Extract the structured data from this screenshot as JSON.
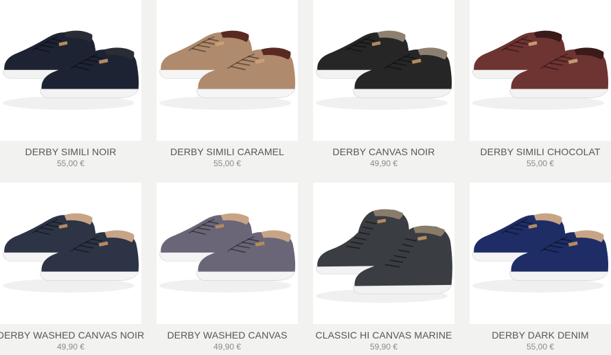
{
  "products": [
    {
      "name": "DERBY SIMILI NOIR",
      "price": "55,00 €",
      "colors": {
        "body": "#1d2333",
        "sole": "#f3f3f3",
        "lining": "#2a2d35",
        "tag": "#b48a5e"
      }
    },
    {
      "name": "DERBY SIMILI CARAMEL",
      "price": "55,00 €",
      "colors": {
        "body": "#b08a6c",
        "sole": "#f5f5f5",
        "lining": "#5a2a22",
        "tag": "#caa07a"
      }
    },
    {
      "name": "DERBY CANVAS NOIR",
      "price": "49,90 €",
      "colors": {
        "body": "#262626",
        "sole": "#f2f2f2",
        "lining": "#8c8070",
        "tag": "#b48a5e"
      }
    },
    {
      "name": "DERBY SIMILI CHOCOLAT",
      "price": "55,00 €",
      "colors": {
        "body": "#6e3432",
        "sole": "#f2f2f2",
        "lining": "#3b1a1a",
        "tag": "#c49a70"
      }
    },
    {
      "name": "DERBY WASHED CANVAS NOIR",
      "price": "49,90 €",
      "colors": {
        "body": "#2c3446",
        "sole": "#f4f4f4",
        "lining": "#c8a486",
        "tag": "#b48a5e"
      }
    },
    {
      "name": "DERBY WASHED CANVAS",
      "price": "49,90 €",
      "colors": {
        "body": "#6a6678",
        "sole": "#f4f4f4",
        "lining": "#c8a486",
        "tag": "#b48a5e"
      }
    },
    {
      "name": "CLASSIC HI CANVAS MARINE",
      "price": "59,90 €",
      "colors": {
        "body": "#3a3d42",
        "sole": "#f2f2f2",
        "lining": "#8a7c6a",
        "tag": "#b48a5e"
      }
    },
    {
      "name": "DERBY DARK DENIM",
      "price": "55,00 €",
      "colors": {
        "body": "#1e2d66",
        "sole": "#f4f4f4",
        "lining": "#c8a486",
        "tag": "#b48a5e"
      }
    }
  ]
}
